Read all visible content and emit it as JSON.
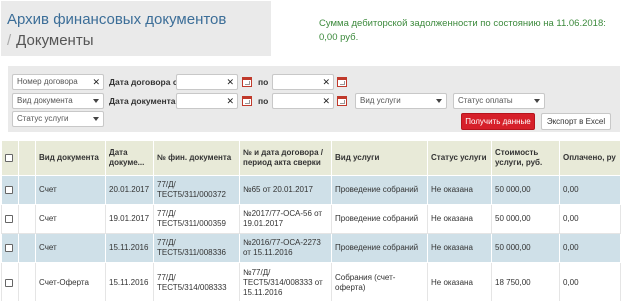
{
  "page": {
    "title": "Архив финансовых документов",
    "breadcrumb_sep": "/",
    "subtitle": "Документы",
    "debt_text": "Сумма дебиторской задолженности по состоянию на 11.06.2018: 0,00 руб."
  },
  "filters": {
    "contract_number_placeholder": "Номер договора",
    "contract_date_from_label": "Дата договора с",
    "contract_date_to_label": "по",
    "doc_type_placeholder": "Вид документа",
    "doc_date_from_label": "Дата документа с",
    "doc_date_to_label": "по",
    "service_type_placeholder": "Вид услуги",
    "payment_status_placeholder": "Статус оплаты",
    "service_status_placeholder": "Статус услуги",
    "clear_glyph": "✕",
    "get_data_button": "Получить данные",
    "export_button": "Экспорт в Excel"
  },
  "table": {
    "headers": {
      "doc_type": "Вид документа",
      "doc_date": "Дата докуме...",
      "fin_doc_num": "№ фин. документа",
      "contract": "№ и дата договора / период акта сверки",
      "service_type": "Вид услуги",
      "service_status": "Статус услуги",
      "cost": "Стоимость услуги, руб.",
      "paid": "Оплачено, ру"
    },
    "rows": [
      {
        "doc_type": "Счет",
        "doc_date": "20.01.2017",
        "fin_doc_num": "77/Д/ТЕСТ5/311/000372",
        "contract": "№65 от 20.01.2017",
        "service_type": "Проведение собраний",
        "service_status": "Не оказана",
        "cost": "50 000,00",
        "paid": "0,00"
      },
      {
        "doc_type": "Счет",
        "doc_date": "19.01.2017",
        "fin_doc_num": "77/Д/ТЕСТ5/311/000359",
        "contract": "№2017/77-ОСА-56 от 19.01.2017",
        "service_type": "Проведение собраний",
        "service_status": "Не оказана",
        "cost": "50 000,00",
        "paid": "0,00"
      },
      {
        "doc_type": "Счет",
        "doc_date": "15.11.2016",
        "fin_doc_num": "77/Д/ТЕСТ5/311/008336",
        "contract": "№2016/77-ОСА-2273 от 15.11.2016",
        "service_type": "Проведение собраний",
        "service_status": "Не оказана",
        "cost": "50 000,00",
        "paid": "0,00"
      },
      {
        "doc_type": "Счет-Оферта",
        "doc_date": "15.11.2016",
        "fin_doc_num": "77/Д/ТЕСТ5/314/008333",
        "contract": "№77/Д/ТЕСТ5/314/008333 от 15.11.2016",
        "service_type": "Собрания (счет-оферта)",
        "service_status": "Не оказана",
        "cost": "18 750,00",
        "paid": "0,00"
      }
    ]
  }
}
